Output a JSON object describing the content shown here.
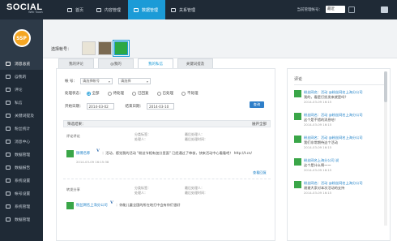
{
  "app": {
    "logo": "SOCIAL",
    "logo_tag": "Web Touch"
  },
  "topnav": [
    {
      "label": "首页"
    },
    {
      "label": "内容管理"
    },
    {
      "label": "数据管理"
    },
    {
      "label": "关系管理"
    }
  ],
  "account_area": {
    "label": "当前管理帐号：",
    "selected": "最近"
  },
  "brand_badge": "SSP",
  "sidebar": [
    {
      "label": "消息总览"
    },
    {
      "label": "@我的"
    },
    {
      "label": "评论"
    },
    {
      "label": "私信"
    },
    {
      "label": "关键词提及"
    },
    {
      "label": "粉丝统计"
    },
    {
      "label": "消息中心"
    },
    {
      "label": "数据管理"
    },
    {
      "label": "数据报告"
    },
    {
      "label": "系统设置"
    },
    {
      "label": "帐号设置"
    },
    {
      "label": "系统管理"
    },
    {
      "label": "数据管理"
    }
  ],
  "account_strip": {
    "label": "选择帐号："
  },
  "tabs": [
    {
      "label": "我的评论"
    },
    {
      "label": "@我的"
    },
    {
      "label": "我的私信"
    },
    {
      "label": "关键词提及"
    }
  ],
  "filters": {
    "type_label": "帐 号：",
    "type_select": "请选择帐号",
    "type_select2": "请选择",
    "status_label": "处理状态：",
    "status_options": [
      {
        "label": "全部",
        "selected": true
      },
      {
        "label": "待处理",
        "selected": false
      },
      {
        "label": "已回复",
        "selected": false
      },
      {
        "label": "已处理",
        "selected": false
      },
      {
        "label": "不处理",
        "selected": false
      }
    ],
    "start_label": "开始日期：",
    "start_value": "2014-03-02",
    "end_label": "结束日期：",
    "end_value": "2014-03-10",
    "query_button": "查询"
  },
  "list": {
    "header_left": "筛选结果：",
    "header_right": "展开全部"
  },
  "messages": [
    {
      "type": "评论评论",
      "meta_category": "分类标签：",
      "meta_handler": "处理人：",
      "meta_status": "最后处理人：",
      "meta_time": "最后处理时间：",
      "author": "微博名称",
      "text": "：活动，感觉我的活动 \"粉丝节相有加分里面\" 已经通过了审核，快来活动中心看看吧！ http://t.cn/",
      "time": "2014-03-09 16:15:38",
      "action": "查看回复"
    },
    {
      "type": "转发分享",
      "meta_category": "分类标签：",
      "meta_handler": "处理人：",
      "meta_status": "最后处理人：",
      "meta_time": "最后处理时间：",
      "author": "粉丝网名上海分公司",
      "text": "：你能儿童全国的所在地打中会有你们很好",
      "time": "",
      "action": ""
    }
  ],
  "right_panel": {
    "title": "评论",
    "items": [
      {
        "name": "粉丝网名：活动 @粉丝网名上海分公司",
        "text": "我的，看是打扰发来就是吗？",
        "time": "2014-03-09 16:15"
      },
      {
        "name": "粉丝网名：活动 @粉丝网名上海分公司",
        "text": "这个是不错的消息哈！",
        "time": "2014-03-09 16:15"
      },
      {
        "name": "粉丝网名：活动 @粉丝网名上海分公司",
        "text": "我们非常期待这个活动",
        "time": "2014-03-09 16:15"
      },
      {
        "name": "粉丝网名上海分公司 说",
        "text": "这个是什么啊～～",
        "time": "2014-03-09 16:15"
      },
      {
        "name": "粉丝网名：活动 @粉丝网名上海分公司",
        "text": "谢谢大家对本次活动的支持",
        "time": "2014-03-09 16:15"
      }
    ]
  }
}
